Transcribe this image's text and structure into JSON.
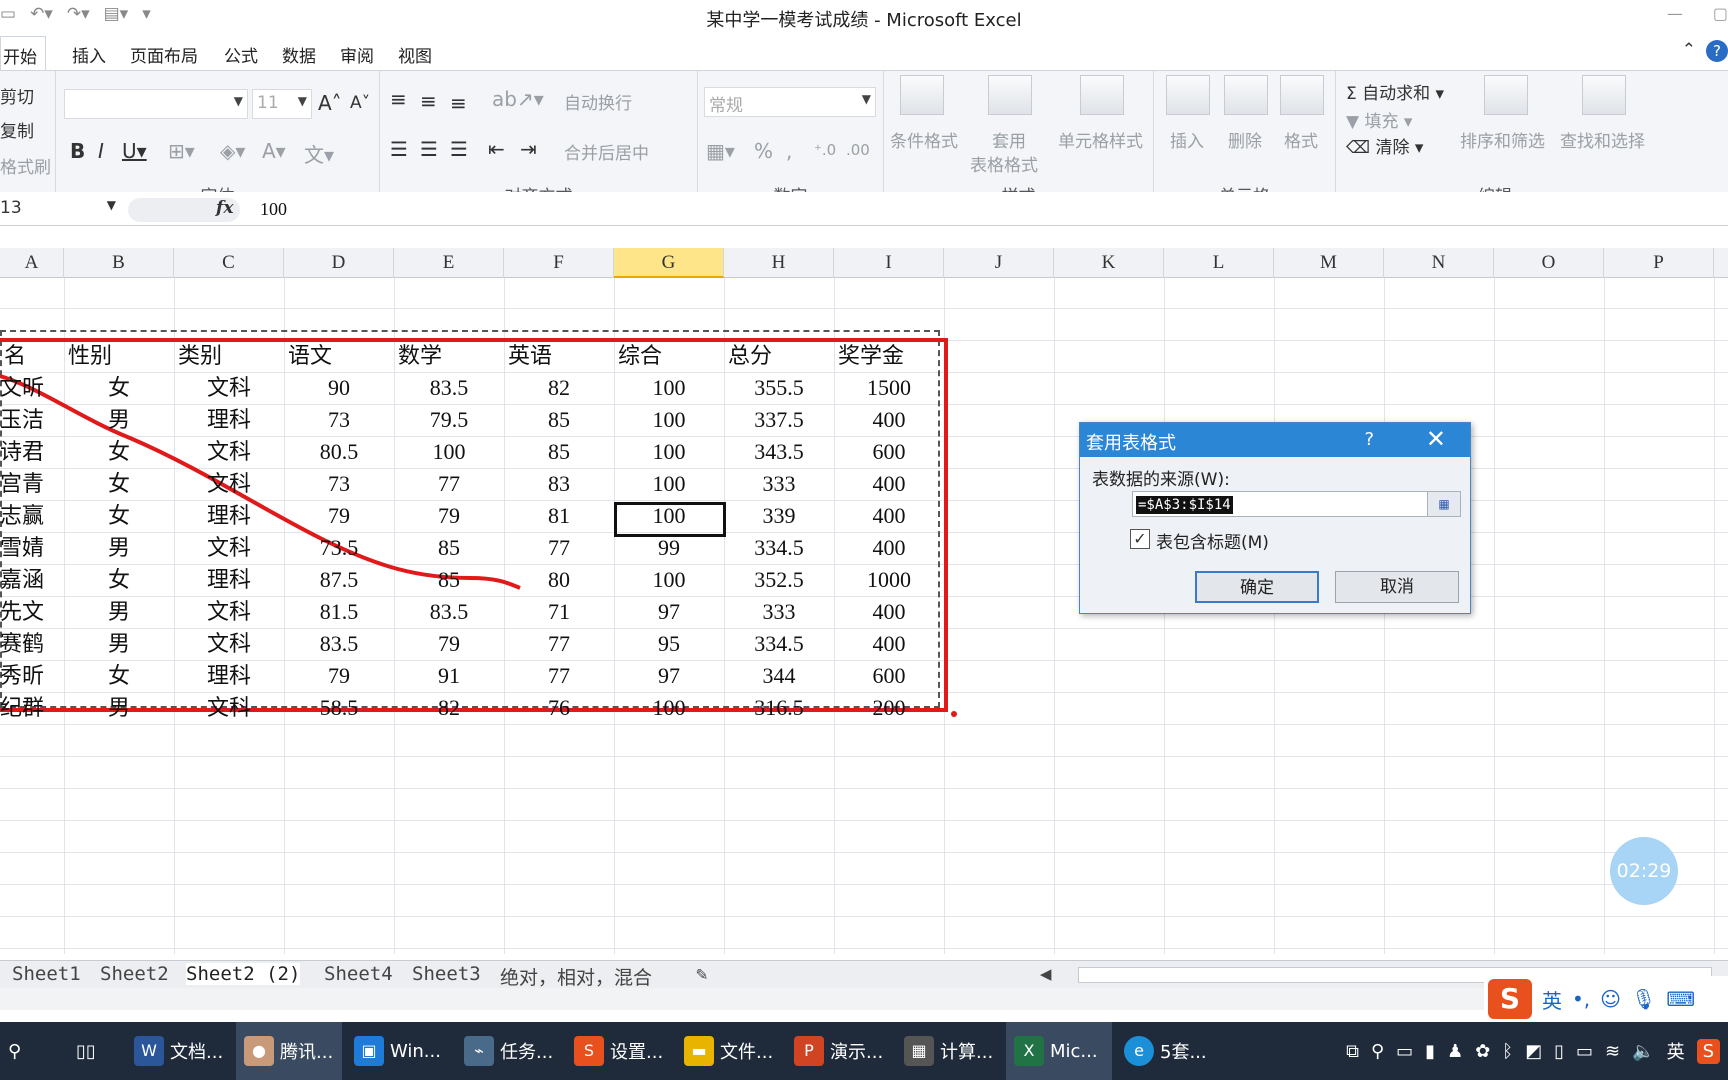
{
  "window": {
    "title": "某中学一模考试成绩 - Microsoft Excel"
  },
  "tabs": [
    "开始",
    "插入",
    "页面布局",
    "公式",
    "数据",
    "审阅",
    "视图"
  ],
  "ribbon": {
    "clipboard": {
      "cut": "剪切",
      "copy": "复制",
      "format_painter": "格式刷"
    },
    "font": {
      "size": "11",
      "label": "字体"
    },
    "alignment": {
      "wrap": "自动换行",
      "merge": "合并后居中",
      "label": "对齐方式"
    },
    "number": {
      "format": "常规",
      "label": "数字"
    },
    "styles": {
      "conditional": "条件格式",
      "table_line1": "套用",
      "table_line2": "表格格式",
      "cell_styles": "单元格样式",
      "label": "样式"
    },
    "cells": {
      "insert": "插入",
      "delete": "删除",
      "format": "格式",
      "label": "单元格"
    },
    "editing": {
      "autosum": "自动求和",
      "fill": "填充",
      "clear": "清除",
      "sort": "排序和筛选",
      "find": "查找和选择",
      "label": "编辑"
    }
  },
  "formula_bar": {
    "name_box": "13",
    "value": "100"
  },
  "columns": [
    "A",
    "B",
    "C",
    "D",
    "E",
    "F",
    "G",
    "H",
    "I",
    "J",
    "K",
    "L",
    "M",
    "N",
    "O",
    "P"
  ],
  "table": {
    "headers": [
      "名",
      "性别",
      "类别",
      "语文",
      "数学",
      "英语",
      "综合",
      "总分",
      "奖学金"
    ],
    "rows": [
      [
        "文昕",
        "女",
        "文科",
        "90",
        "83.5",
        "82",
        "100",
        "355.5",
        "1500"
      ],
      [
        "玉洁",
        "男",
        "理科",
        "73",
        "79.5",
        "85",
        "100",
        "337.5",
        "400"
      ],
      [
        "诗君",
        "女",
        "文科",
        "80.5",
        "100",
        "85",
        "100",
        "343.5",
        "600"
      ],
      [
        "宫青",
        "女",
        "文科",
        "73",
        "77",
        "83",
        "100",
        "333",
        "400"
      ],
      [
        "志赢",
        "女",
        "理科",
        "79",
        "79",
        "81",
        "100",
        "339",
        "400"
      ],
      [
        "雪婧",
        "男",
        "文科",
        "73.5",
        "85",
        "77",
        "99",
        "334.5",
        "400"
      ],
      [
        "嘉涵",
        "女",
        "理科",
        "87.5",
        "85",
        "80",
        "100",
        "352.5",
        "1000"
      ],
      [
        "先文",
        "男",
        "文科",
        "81.5",
        "83.5",
        "71",
        "97",
        "333",
        "400"
      ],
      [
        "赛鹤",
        "男",
        "文科",
        "83.5",
        "79",
        "77",
        "95",
        "334.5",
        "400"
      ],
      [
        "秀昕",
        "女",
        "理科",
        "79",
        "91",
        "77",
        "97",
        "344",
        "600"
      ],
      [
        "纪群",
        "男",
        "文科",
        "58.5",
        "82",
        "76",
        "100",
        "316.5",
        "200"
      ]
    ]
  },
  "dialog": {
    "title": "套用表格式",
    "help": "?",
    "source_label": "表数据的来源(W):",
    "source_value": "=$A$3:$I$14",
    "has_headers_label": "表包含标题(M)",
    "has_headers_checked": true,
    "ok": "确定",
    "cancel": "取消"
  },
  "sheet_tabs": [
    "Sheet1",
    "Sheet2",
    "Sheet2 (2)",
    "Sheet4",
    "Sheet3",
    "绝对，相对，混合"
  ],
  "active_sheet": "Sheet2 (2)",
  "timer": "02:29",
  "ime": {
    "mode": "英"
  },
  "taskbar": {
    "items": [
      "文档...",
      "腾讯...",
      "Win...",
      "任务...",
      "设置...",
      "文件...",
      "演示...",
      "计算...",
      "Mic...",
      "5套..."
    ],
    "tray_lang": "英"
  },
  "colors": {
    "accent": "#2c86d6",
    "highlight_red": "#e01a1a",
    "selected_col": "#ffe58a"
  }
}
